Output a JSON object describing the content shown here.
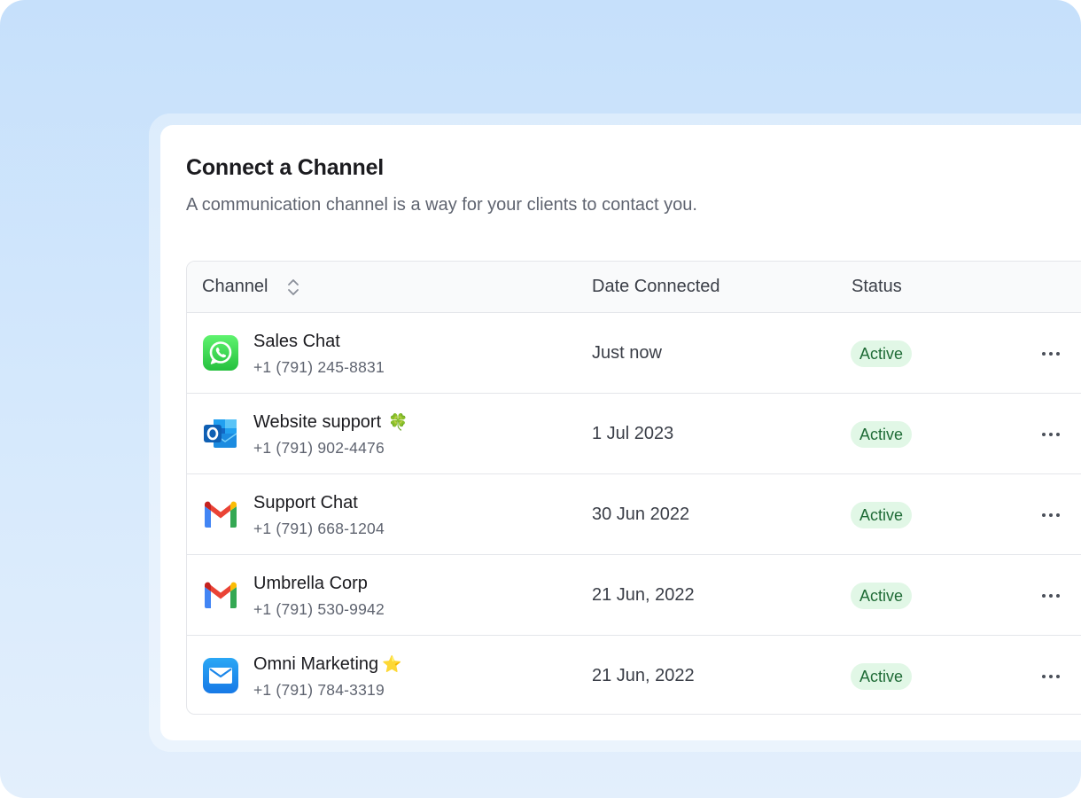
{
  "card": {
    "title": "Connect a Channel",
    "subtitle": "A communication channel is a way for your clients to contact you."
  },
  "table": {
    "columns": {
      "channel": "Channel",
      "date": "Date Connected",
      "status": "Status"
    },
    "rows": [
      {
        "name": "Sales Chat",
        "emoji": "",
        "phone": "+1 (791) 245-8831",
        "date": "Just now",
        "status": "Active",
        "icon": "whatsapp-icon"
      },
      {
        "name": "Website support",
        "emoji": "🍀",
        "phone": "+1 (791) 902-4476",
        "date": "1 Jul 2023",
        "status": "Active",
        "icon": "outlook-icon"
      },
      {
        "name": "Support Chat",
        "emoji": "",
        "phone": "+1 (791) 668-1204",
        "date": "30 Jun 2022",
        "status": "Active",
        "icon": "gmail-icon"
      },
      {
        "name": "Umbrella Corp",
        "emoji": "",
        "phone": "+1 (791) 530-9942",
        "date": "21 Jun, 2022",
        "status": "Active",
        "icon": "gmail-icon"
      },
      {
        "name": "Omni Marketing",
        "emoji": "⭐",
        "phone": "+1 (791) 784-3319",
        "date": "21 Jun, 2022",
        "status": "Active",
        "icon": "mail-icon"
      }
    ]
  },
  "colors": {
    "background": "#c6e0fb",
    "status_badge_bg": "#e1f7e6",
    "status_badge_text": "#1f6b36"
  }
}
